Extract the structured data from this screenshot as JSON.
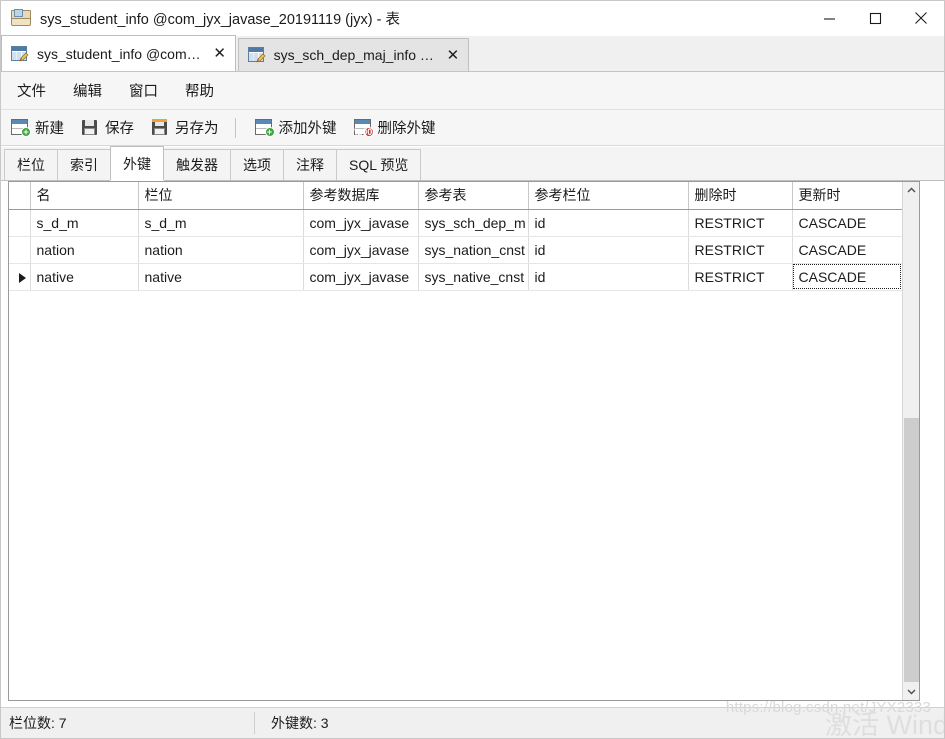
{
  "window": {
    "title": "sys_student_info @com_jyx_javase_20191119 (jyx) - 表",
    "icon": "table-window-icon",
    "minimize_label": "—",
    "maximize_label": "□",
    "close_label": "✕"
  },
  "document_tabs": [
    {
      "label": "sys_student_info @com…",
      "icon": "table-edit-icon",
      "close": "✕",
      "active": true
    },
    {
      "label": "sys_sch_dep_maj_info …",
      "icon": "table-edit-icon",
      "close": "✕",
      "active": false
    }
  ],
  "menu": {
    "items": [
      {
        "label": "文件"
      },
      {
        "label": "编辑"
      },
      {
        "label": "窗口"
      },
      {
        "label": "帮助"
      }
    ]
  },
  "toolbar": {
    "buttons": [
      {
        "label": "新建",
        "icon": "new-table-icon"
      },
      {
        "label": "保存",
        "icon": "save-icon"
      },
      {
        "label": "另存为",
        "icon": "save-as-icon"
      },
      {
        "label": "添加外键",
        "icon": "add-foreign-key-icon"
      },
      {
        "label": "删除外键",
        "icon": "delete-foreign-key-icon"
      }
    ]
  },
  "property_tabs": [
    {
      "label": "栏位",
      "active": false
    },
    {
      "label": "索引",
      "active": false
    },
    {
      "label": "外键",
      "active": true
    },
    {
      "label": "触发器",
      "active": false
    },
    {
      "label": "选项",
      "active": false
    },
    {
      "label": "注释",
      "active": false
    },
    {
      "label": "SQL 预览",
      "active": false
    }
  ],
  "grid": {
    "columns": [
      {
        "label": "名",
        "width": 108
      },
      {
        "label": "栏位",
        "width": 165
      },
      {
        "label": "参考数据库",
        "width": 115
      },
      {
        "label": "参考表",
        "width": 110
      },
      {
        "label": "参考栏位",
        "width": 160
      },
      {
        "label": "删除时",
        "width": 104
      },
      {
        "label": "更新时",
        "width": 110
      }
    ],
    "rows": [
      {
        "marker": "",
        "cells": [
          "s_d_m",
          "s_d_m",
          "com_jyx_javase",
          "sys_sch_dep_m",
          "id",
          "RESTRICT",
          "CASCADE"
        ]
      },
      {
        "marker": "",
        "cells": [
          "nation",
          "nation",
          "com_jyx_javase",
          "sys_nation_cnst",
          "id",
          "RESTRICT",
          "CASCADE"
        ]
      },
      {
        "marker": "▶",
        "cells": [
          "native",
          "native",
          "com_jyx_javase",
          "sys_native_cnst",
          "id",
          "RESTRICT",
          "CASCADE"
        ]
      }
    ],
    "selected_cell": {
      "row": 2,
      "col": 6
    },
    "scrollbar": {
      "up_arrow": "⌃",
      "down_arrow": "⌄"
    }
  },
  "status": {
    "columns_count": "栏位数: 7",
    "foreign_keys_count": "外键数: 3"
  },
  "watermarks": {
    "url": "https://blog.csdn.net/JYX2333",
    "activate": "激活 Wind"
  },
  "colors": {
    "selection_blue": "#0f7fdb",
    "titlebar_bg": "#ffffff",
    "chrome_bg": "#f0f0f0"
  }
}
